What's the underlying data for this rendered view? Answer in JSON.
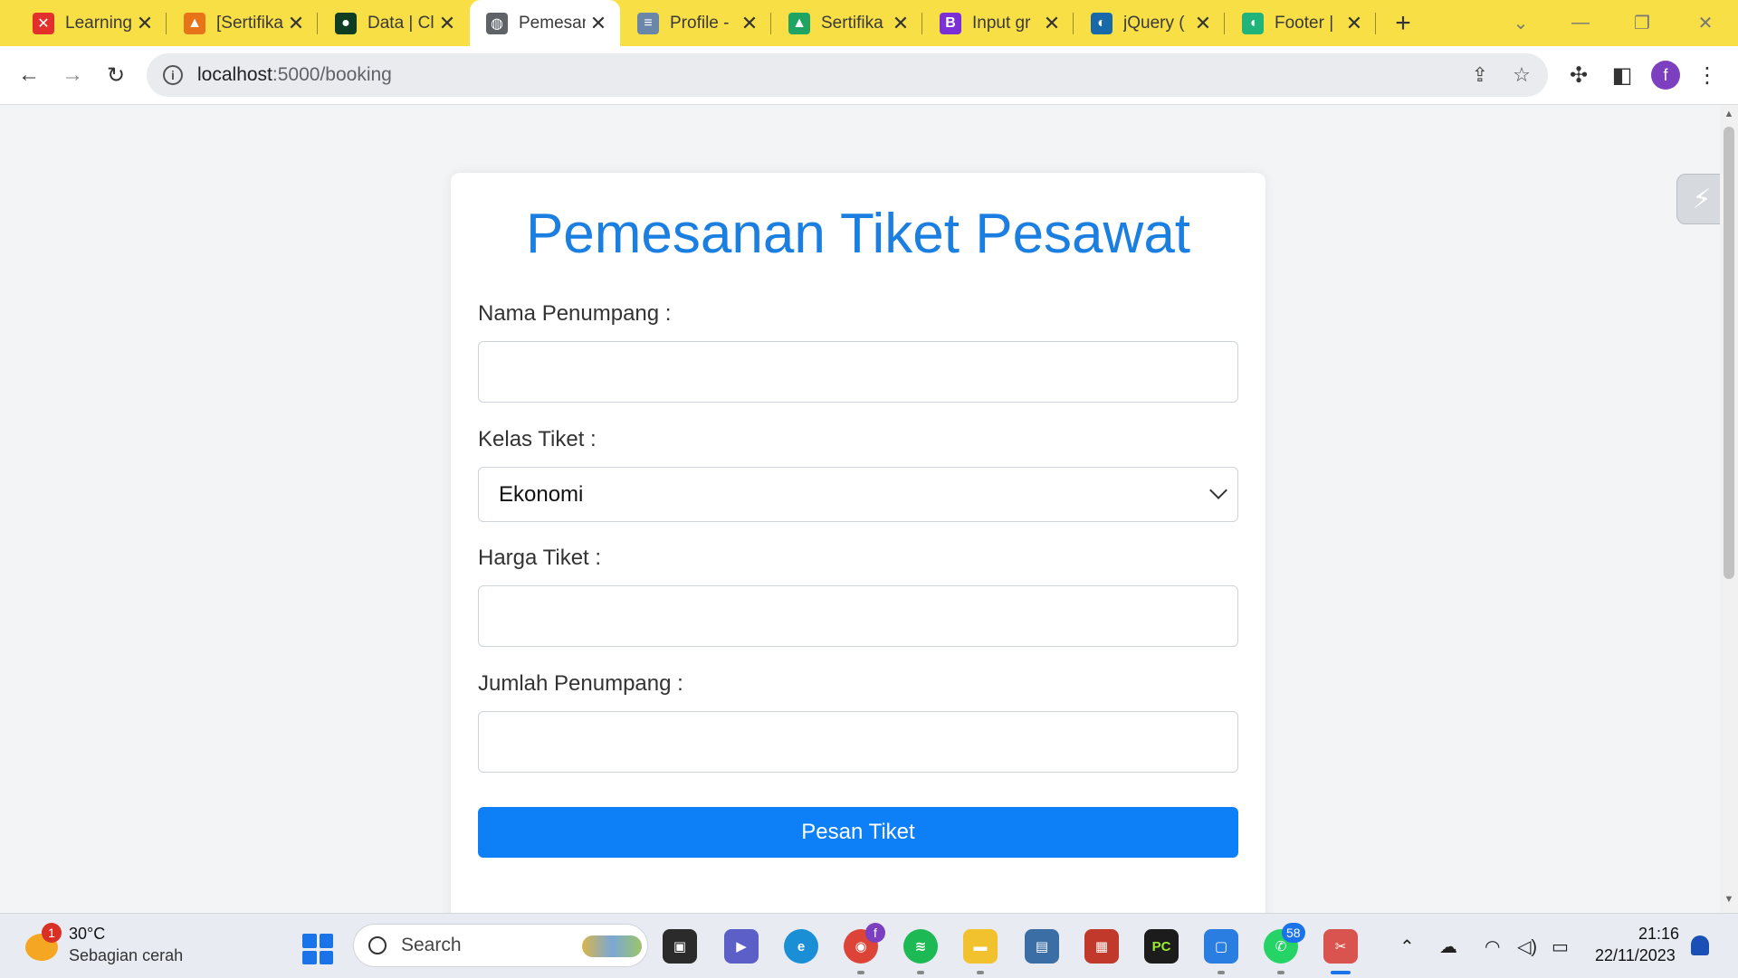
{
  "browser": {
    "tabs": [
      {
        "label": "Learning",
        "icon": "dicoding-icon",
        "color": "#e2312d",
        "glyph": "✕"
      },
      {
        "label": "[Sertifika",
        "icon": "profile-orange-icon",
        "color": "#e8741a",
        "glyph": "▲"
      },
      {
        "label": "Data | Cl",
        "icon": "mongodb-icon",
        "color": "#0f3d22",
        "glyph": "●"
      },
      {
        "label": "Pemesan",
        "icon": "globe-icon",
        "color": "#5f6368",
        "glyph": "◍"
      },
      {
        "label": "Profile -",
        "icon": "profile-logo-icon",
        "color": "#6a86a8",
        "glyph": "≡"
      },
      {
        "label": "Sertifika",
        "icon": "google-drive-icon",
        "color": "#1fa463",
        "glyph": "▲"
      },
      {
        "label": "Input gr",
        "icon": "bootstrap-icon",
        "color": "#7b2fd6",
        "glyph": "B"
      },
      {
        "label": "jQuery (",
        "icon": "jquery-icon",
        "color": "#1769aa",
        "glyph": "◐"
      },
      {
        "label": "Footer |",
        "icon": "footer-site-icon",
        "color": "#20b37a",
        "glyph": "◖"
      }
    ],
    "active_tab": 3,
    "url_host": "localhost",
    "url_path": ":5000/booking",
    "avatar_letter": "f"
  },
  "form": {
    "title": "Pemesanan Tiket Pesawat",
    "name_label": "Nama Penumpang :",
    "class_label": "Kelas Tiket :",
    "class_value": "Ekonomi",
    "price_label": "Harga Tiket :",
    "count_label": "Jumlah Penumpang :",
    "submit_label": "Pesan Tiket",
    "accent_color": "#1a7fe0",
    "button_color": "#0d7ff7"
  },
  "taskbar": {
    "weather_temp": "30°C",
    "weather_desc": "Sebagian cerah",
    "weather_badge": "1",
    "search_placeholder": "Search",
    "chrome_badge": "f",
    "whatsapp_badge": "58",
    "time": "21:16",
    "date": "22/11/2023"
  }
}
